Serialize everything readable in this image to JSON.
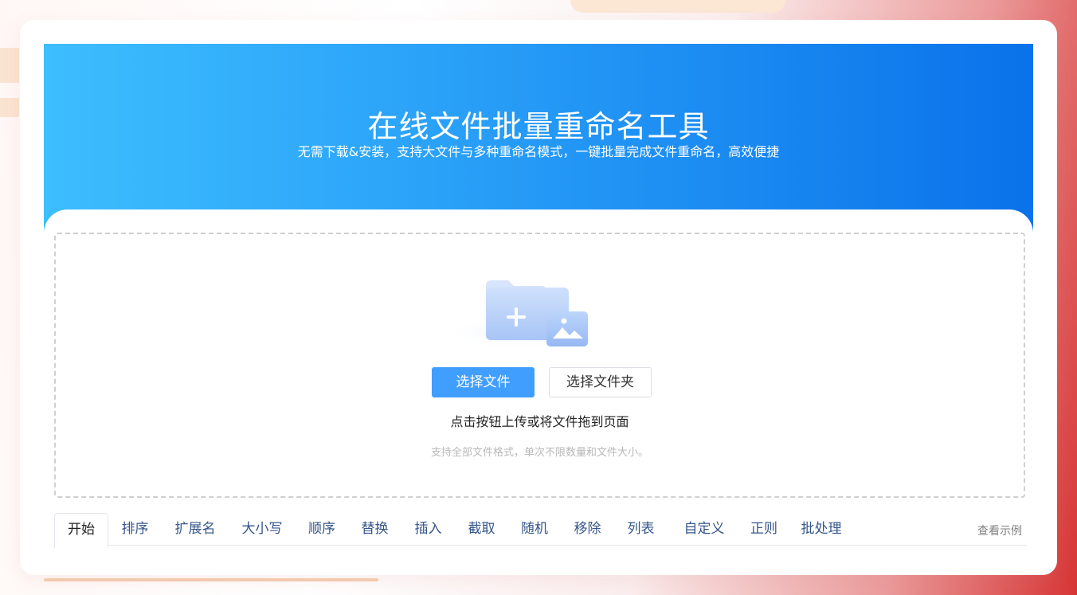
{
  "hero": {
    "title": "在线文件批量重命名工具",
    "subtitle": "无需下载&安装，支持大文件与多种重命名模式，一键批量完成文件重命名，高效便捷"
  },
  "upload": {
    "illustration_icon": "folder-plus-image-icon",
    "select_files_label": "选择文件",
    "select_folder_label": "选择文件夹",
    "hint": "点击按钮上传或将文件拖到页面",
    "note": "支持全部文件格式，单次不限数量和文件大小。"
  },
  "tabs": {
    "items": [
      "开始",
      "排序",
      "扩展名",
      "大小写",
      "顺序",
      "替换",
      "插入",
      "截取",
      "随机",
      "移除",
      "列表",
      "自定义",
      "正则",
      "批处理"
    ],
    "active_index": 0,
    "example_link": "查看示例"
  },
  "colors": {
    "hero_gradient_start": "#3dbefe",
    "hero_gradient_end": "#0a72ea",
    "primary": "#409eff",
    "tab_text": "#35568a"
  }
}
